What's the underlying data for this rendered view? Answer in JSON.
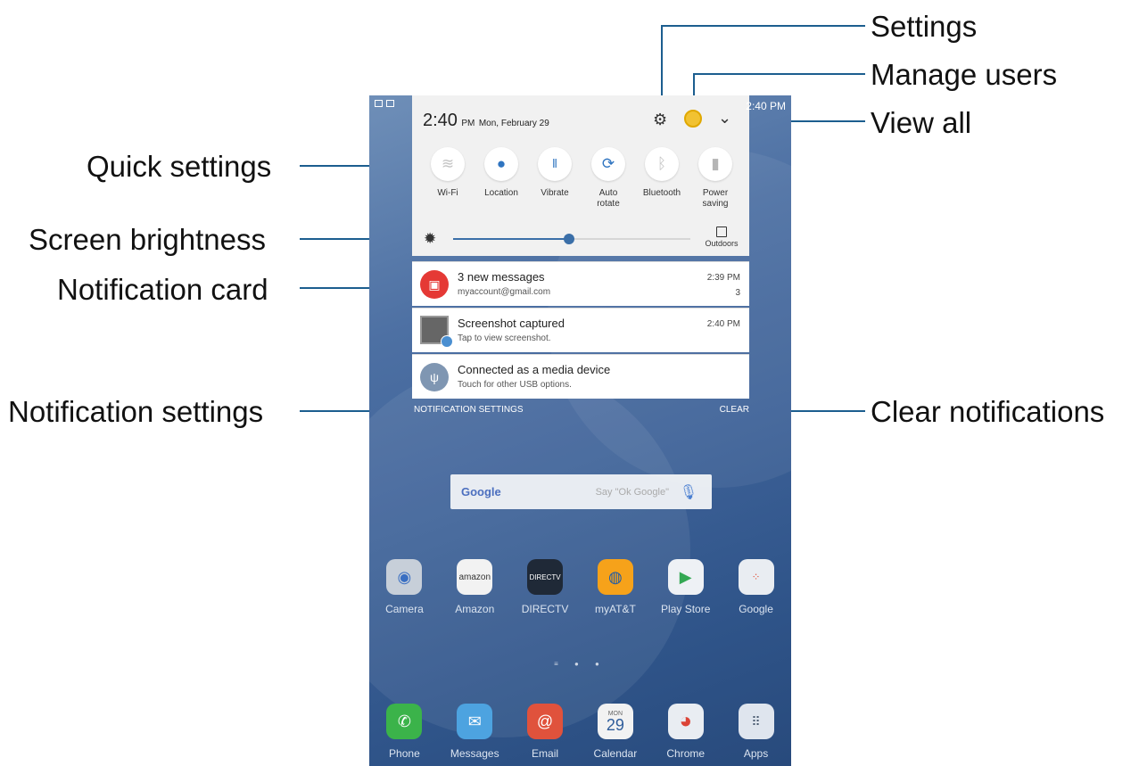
{
  "callouts": {
    "settings": "Settings",
    "manage_users": "Manage users",
    "view_all": "View all",
    "quick_settings": "Quick settings",
    "screen_brightness": "Screen brightness",
    "notification_card": "Notification card",
    "notification_settings": "Notification settings",
    "clear_notifications": "Clear notifications"
  },
  "status_bar": {
    "time": "2:40 PM"
  },
  "panel": {
    "time": "2:40",
    "ampm": "PM",
    "date": "Mon, February 29",
    "icons": {
      "settings": "gear-icon",
      "users": "avatar-icon",
      "view_all": "chevron-down-icon"
    },
    "tiles": [
      {
        "label": "Wi-Fi",
        "icon": "wifi-icon"
      },
      {
        "label": "Location",
        "icon": "location-icon"
      },
      {
        "label": "Vibrate",
        "icon": "vibrate-icon"
      },
      {
        "label": "Auto\nrotate",
        "icon": "rotate-icon"
      },
      {
        "label": "Bluetooth",
        "icon": "bluetooth-icon"
      },
      {
        "label": "Power\nsaving",
        "icon": "battery-icon"
      }
    ],
    "brightness": {
      "level": 0.49,
      "outdoors_label": "Outdoors"
    }
  },
  "notifications": [
    {
      "title": "3 new messages",
      "subtitle": "myaccount@gmail.com",
      "time": "2:39 PM",
      "count": "3",
      "icon_color": "#e53935"
    },
    {
      "title": "Screenshot captured",
      "subtitle": "Tap to view screenshot.",
      "time": "2:40 PM"
    },
    {
      "title": "Connected as a media device",
      "subtitle": "Touch for other USB options.",
      "icon_color": "#7f96b2"
    }
  ],
  "footer": {
    "settings_label": "NOTIFICATION SETTINGS",
    "clear_label": "CLEAR"
  },
  "search": {
    "logo": "Google",
    "hint": "Say \"Ok Google\""
  },
  "apps": [
    {
      "label": "Camera",
      "color": "#c7cfd9"
    },
    {
      "label": "Amazon",
      "color": "#f2f2f2"
    },
    {
      "label": "DIRECTV",
      "color": "#1f2937"
    },
    {
      "label": "myAT&T",
      "color": "#f6a21a"
    },
    {
      "label": "Play Store",
      "color": "#eef1f5"
    },
    {
      "label": "Google",
      "color": "#e9edf2"
    }
  ],
  "dock": [
    {
      "label": "Phone",
      "color": "#3bb34a"
    },
    {
      "label": "Messages",
      "color": "#4da3e0"
    },
    {
      "label": "Email",
      "color": "#e0523c"
    },
    {
      "label": "Calendar",
      "color": "#f2f2f2",
      "day": "MON",
      "date": "29"
    },
    {
      "label": "Chrome",
      "color": "#e9edf2"
    },
    {
      "label": "Apps",
      "color": "#dfe5ee"
    }
  ]
}
